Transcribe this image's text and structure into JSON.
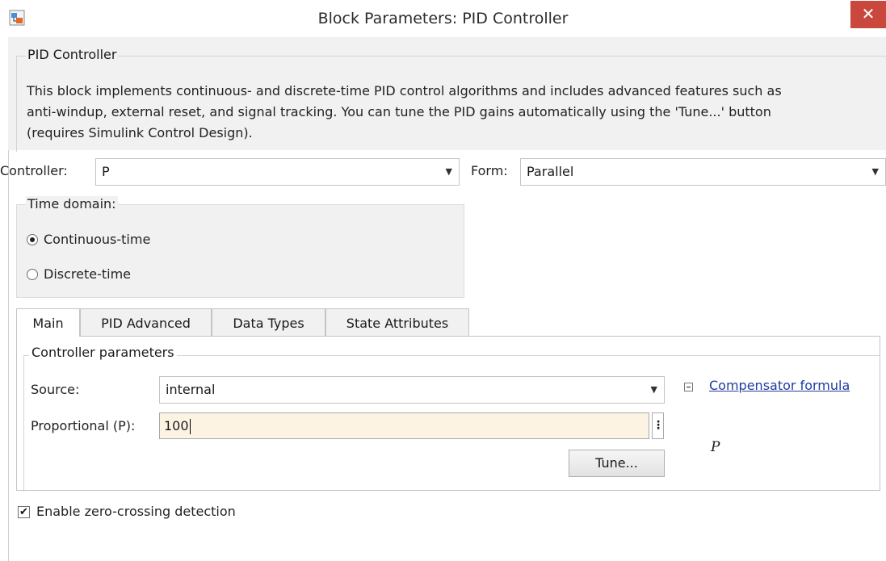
{
  "window": {
    "title": "Block Parameters: PID Controller",
    "close_glyph": "✕",
    "app_icon": "simulink-block-icon"
  },
  "description": {
    "legend": "PID Controller",
    "lines": [
      "This block implements continuous- and discrete-time PID control algorithms and includes advanced features such as",
      "anti-windup, external reset, and signal tracking. You can tune the PID gains automatically using the 'Tune...' button",
      "(requires Simulink Control Design)."
    ]
  },
  "controller": {
    "label": "Controller:",
    "value": "P"
  },
  "form": {
    "label": "Form:",
    "value": "Parallel"
  },
  "time_domain": {
    "legend": "Time domain:",
    "options": [
      {
        "label": "Continuous-time",
        "selected": true
      },
      {
        "label": "Discrete-time",
        "selected": false
      }
    ]
  },
  "tabs": [
    {
      "label": "Main",
      "active": true
    },
    {
      "label": "PID Advanced",
      "active": false
    },
    {
      "label": "Data Types",
      "active": false
    },
    {
      "label": "State Attributes",
      "active": false
    }
  ],
  "controller_parameters": {
    "legend": "Controller parameters",
    "source_label": "Source:",
    "source_value": "internal",
    "proportional_label": "Proportional (P):",
    "proportional_value": "100",
    "more_glyph": "⋮",
    "tune_label": "Tune...",
    "compensator_link": "Compensator formula",
    "formula": "P"
  },
  "zero_crossing": {
    "label": "Enable zero-crossing detection",
    "checked": true,
    "check_glyph": "✔"
  },
  "colors": {
    "close_button": "#c9473c",
    "input_highlight": "#fdf3e3",
    "link": "#1f3ca0",
    "panel_gray": "#f1f1f1"
  }
}
